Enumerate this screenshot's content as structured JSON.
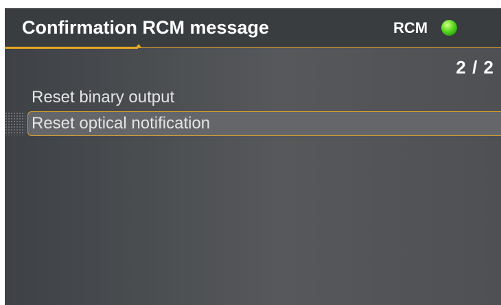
{
  "header": {
    "title": "Confirmation RCM message",
    "indicator_label": "RCM",
    "indicator_status": "green",
    "accent_color": "#e8a821"
  },
  "pagination": {
    "text": "2 / 2"
  },
  "menu": {
    "items": [
      {
        "label": "Reset binary output",
        "selected": false
      },
      {
        "label": "Reset optical notification",
        "selected": true
      }
    ]
  }
}
